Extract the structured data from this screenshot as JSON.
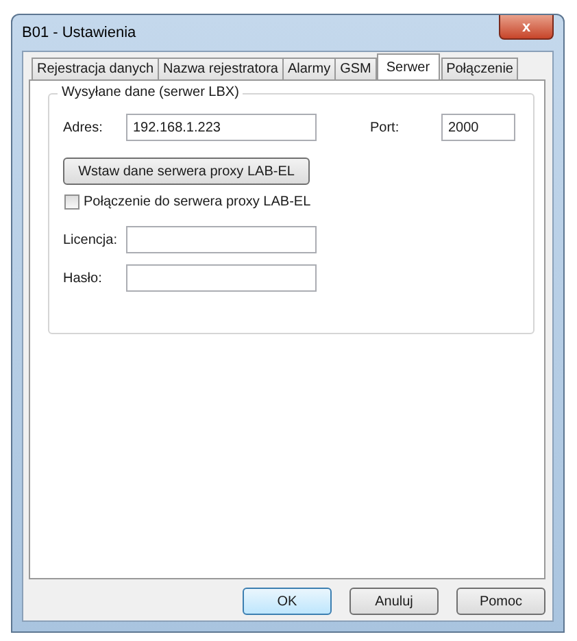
{
  "window": {
    "title": "B01 - Ustawienia",
    "close": "x"
  },
  "tabs": [
    {
      "label": "Rejestracja danych",
      "selected": false
    },
    {
      "label": "Nazwa rejestratora",
      "selected": false
    },
    {
      "label": "Alarmy",
      "selected": false
    },
    {
      "label": "GSM",
      "selected": false
    },
    {
      "label": "Serwer",
      "selected": true
    },
    {
      "label": "Połączenie",
      "selected": false
    }
  ],
  "group": {
    "title": "Wysyłane dane (serwer LBX)",
    "address": {
      "label": "Adres:",
      "value": "192.168.1.223"
    },
    "port": {
      "label": "Port:",
      "value": "2000"
    },
    "proxy_button": "Wstaw dane serwera proxy LAB-EL",
    "proxy_checkbox": {
      "label": "Połączenie do serwera proxy LAB-EL",
      "checked": false
    },
    "license": {
      "label": "Licencja:"
    },
    "password": {
      "label": "Hasło:"
    }
  },
  "buttons": [
    {
      "label": "OK",
      "default": true
    },
    {
      "label": "Anuluj",
      "default": false
    },
    {
      "label": "Pomoc",
      "default": false
    }
  ]
}
